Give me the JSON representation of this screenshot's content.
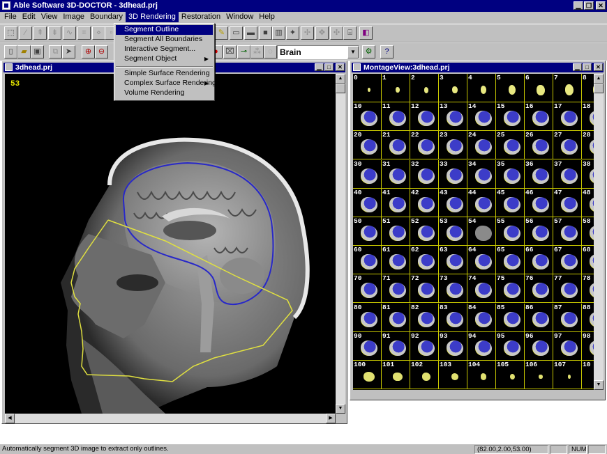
{
  "app": {
    "title": "Able Software 3D-DOCTOR - 3dhead.prj"
  },
  "menubar": {
    "items": [
      "File",
      "Edit",
      "View",
      "Image",
      "Boundary",
      "3D Rendering",
      "Restoration",
      "Window",
      "Help"
    ],
    "active_index": 5
  },
  "toolbar": {
    "object_combo_value": "Brain"
  },
  "dropdown": {
    "items": [
      {
        "label": "Segment Outline",
        "selected": true,
        "submenu": false
      },
      {
        "label": "Segment All Boundaries",
        "selected": false,
        "submenu": false
      },
      {
        "label": "Interactive Segment...",
        "selected": false,
        "submenu": false
      },
      {
        "label": "Segment Object",
        "selected": false,
        "submenu": true
      },
      {
        "separator": true
      },
      {
        "label": "Simple Surface Rendering",
        "selected": false,
        "submenu": false
      },
      {
        "label": "Complex Surface Rendering",
        "selected": false,
        "submenu": true
      },
      {
        "label": "Volume Rendering",
        "selected": false,
        "submenu": false
      }
    ]
  },
  "image_window": {
    "title": "3dhead.prj",
    "slice_number": "53"
  },
  "montage_window": {
    "title": "MontageView:3dhead.prj",
    "slice_labels": [
      "0",
      "1",
      "2",
      "3",
      "4",
      "5",
      "6",
      "7",
      "8",
      "10",
      "11",
      "12",
      "13",
      "14",
      "15",
      "16",
      "17",
      "18",
      "20",
      "21",
      "22",
      "23",
      "24",
      "25",
      "26",
      "27",
      "28",
      "30",
      "31",
      "32",
      "33",
      "34",
      "35",
      "36",
      "37",
      "38",
      "40",
      "41",
      "42",
      "43",
      "44",
      "45",
      "46",
      "47",
      "48",
      "50",
      "51",
      "52",
      "53",
      "54",
      "55",
      "56",
      "57",
      "58",
      "60",
      "61",
      "62",
      "63",
      "64",
      "65",
      "66",
      "67",
      "68",
      "70",
      "71",
      "72",
      "73",
      "74",
      "75",
      "76",
      "77",
      "78",
      "80",
      "81",
      "82",
      "83",
      "84",
      "85",
      "86",
      "87",
      "88",
      "90",
      "91",
      "92",
      "93",
      "94",
      "95",
      "96",
      "97",
      "98",
      "100",
      "101",
      "102",
      "103",
      "104",
      "105",
      "106",
      "107",
      "10"
    ]
  },
  "statusbar": {
    "message": "Automatically segment 3D image to extract only outlines.",
    "coords": "(82.00,2.00,53.00)",
    "num": "NUM"
  },
  "colors": {
    "titlebar": "#000080",
    "boundary_blue": "#2828c8",
    "boundary_yellow": "#e0e040",
    "grid_yellow": "#c8c800"
  }
}
